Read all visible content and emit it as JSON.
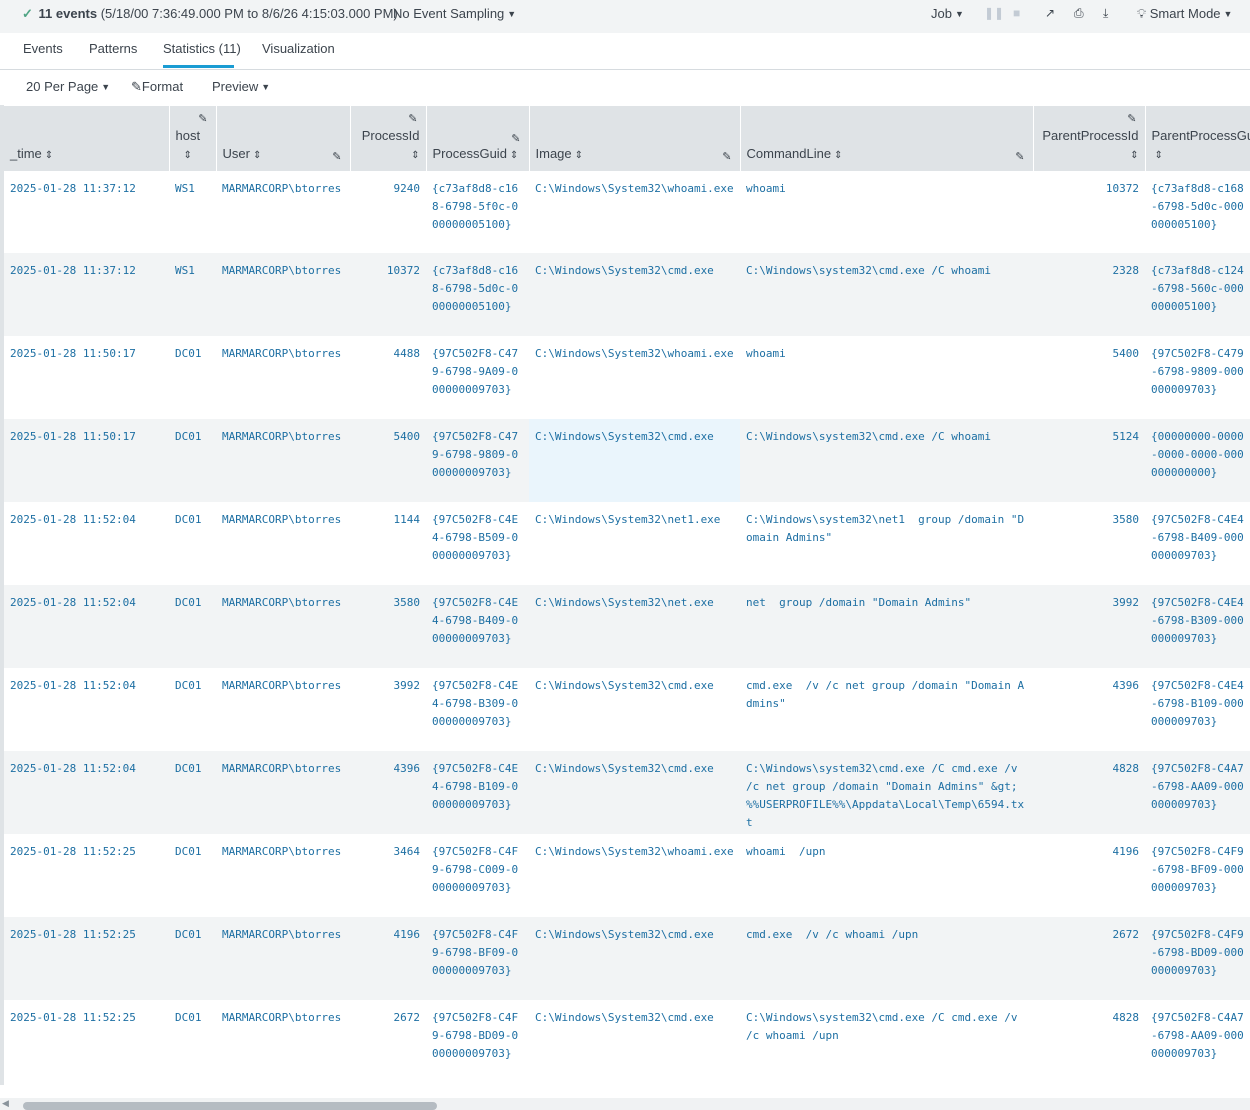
{
  "search_status": {
    "check": "✓",
    "count_label": "11 events",
    "range_label": "(5/18/00 7:36:49.000 PM to 8/6/26 4:15:03.000 PM)",
    "sampling_label": "No Event Sampling",
    "job_label": "Job",
    "mode_label": "Smart Mode"
  },
  "tabs": [
    {
      "label": "Events"
    },
    {
      "label": "Patterns"
    },
    {
      "label": "Statistics (11)"
    },
    {
      "label": "Visualization"
    }
  ],
  "toolbar": {
    "per_page": "20 Per Page",
    "format": "Format",
    "preview": "Preview"
  },
  "columns": {
    "time": "_time",
    "host": "host",
    "user": "User",
    "pid": "ProcessId",
    "pguid": "ProcessGuid",
    "image": "Image",
    "cmd": "CommandLine",
    "ppid": "ParentProcessId",
    "ppguid": "ParentProcessGuid"
  },
  "rows": [
    {
      "time": "2025-01-28 11:37:12",
      "host": "WS1",
      "user": "MARMARCORP\\btorres",
      "pid": "9240",
      "pguid": "{c73af8d8-c168-6798-5f0c-000000005100}",
      "image": "C:\\Windows\\System32\\whoami.exe",
      "cmd": "whoami",
      "ppid": "10372",
      "ppguid": "{c73af8d8-c168-6798-5d0c-000000005100}"
    },
    {
      "time": "2025-01-28 11:37:12",
      "host": "WS1",
      "user": "MARMARCORP\\btorres",
      "pid": "10372",
      "pguid": "{c73af8d8-c168-6798-5d0c-000000005100}",
      "image": "C:\\Windows\\System32\\cmd.exe",
      "cmd": "C:\\Windows\\system32\\cmd.exe /C whoami",
      "ppid": "2328",
      "ppguid": "{c73af8d8-c124-6798-560c-000000005100}"
    },
    {
      "time": "2025-01-28 11:50:17",
      "host": "DC01",
      "user": "MARMARCORP\\btorres",
      "pid": "4488",
      "pguid": "{97C502F8-C479-6798-9A09-000000009703}",
      "image": "C:\\Windows\\System32\\whoami.exe",
      "cmd": "whoami",
      "ppid": "5400",
      "ppguid": "{97C502F8-C479-6798-9809-000000009703}"
    },
    {
      "time": "2025-01-28 11:50:17",
      "host": "DC01",
      "user": "MARMARCORP\\btorres",
      "pid": "5400",
      "pguid": "{97C502F8-C479-6798-9809-000000009703}",
      "image": "C:\\Windows\\System32\\cmd.exe",
      "cmd": "C:\\Windows\\system32\\cmd.exe /C whoami",
      "ppid": "5124",
      "ppguid": "{00000000-0000-0000-0000-000000000000}"
    },
    {
      "time": "2025-01-28 11:52:04",
      "host": "DC01",
      "user": "MARMARCORP\\btorres",
      "pid": "1144",
      "pguid": "{97C502F8-C4E4-6798-B509-000000009703}",
      "image": "C:\\Windows\\System32\\net1.exe",
      "cmd": "C:\\Windows\\system32\\net1  group /domain \"Domain Admins\"",
      "ppid": "3580",
      "ppguid": "{97C502F8-C4E4-6798-B409-000000009703}"
    },
    {
      "time": "2025-01-28 11:52:04",
      "host": "DC01",
      "user": "MARMARCORP\\btorres",
      "pid": "3580",
      "pguid": "{97C502F8-C4E4-6798-B409-000000009703}",
      "image": "C:\\Windows\\System32\\net.exe",
      "cmd": "net  group /domain \"Domain Admins\"",
      "ppid": "3992",
      "ppguid": "{97C502F8-C4E4-6798-B309-000000009703}"
    },
    {
      "time": "2025-01-28 11:52:04",
      "host": "DC01",
      "user": "MARMARCORP\\btorres",
      "pid": "3992",
      "pguid": "{97C502F8-C4E4-6798-B309-000000009703}",
      "image": "C:\\Windows\\System32\\cmd.exe",
      "cmd": "cmd.exe  /v /c net group /domain \"Domain Admins\"",
      "ppid": "4396",
      "ppguid": "{97C502F8-C4E4-6798-B109-000000009703}"
    },
    {
      "time": "2025-01-28 11:52:04",
      "host": "DC01",
      "user": "MARMARCORP\\btorres",
      "pid": "4396",
      "pguid": "{97C502F8-C4E4-6798-B109-000000009703}",
      "image": "C:\\Windows\\System32\\cmd.exe",
      "cmd": "C:\\Windows\\system32\\cmd.exe /C cmd.exe /v /c net group /domain \"Domain Admins\" &gt; %%USERPROFILE%%\\Appdata\\Local\\Temp\\6594.txt",
      "ppid": "4828",
      "ppguid": "{97C502F8-C4A7-6798-AA09-000000009703}"
    },
    {
      "time": "2025-01-28 11:52:25",
      "host": "DC01",
      "user": "MARMARCORP\\btorres",
      "pid": "3464",
      "pguid": "{97C502F8-C4F9-6798-C009-000000009703}",
      "image": "C:\\Windows\\System32\\whoami.exe",
      "cmd": "whoami  /upn",
      "ppid": "4196",
      "ppguid": "{97C502F8-C4F9-6798-BF09-000000009703}"
    },
    {
      "time": "2025-01-28 11:52:25",
      "host": "DC01",
      "user": "MARMARCORP\\btorres",
      "pid": "4196",
      "pguid": "{97C502F8-C4F9-6798-BF09-000000009703}",
      "image": "C:\\Windows\\System32\\cmd.exe",
      "cmd": "cmd.exe  /v /c whoami /upn",
      "ppid": "2672",
      "ppguid": "{97C502F8-C4F9-6798-BD09-000000009703}"
    },
    {
      "time": "2025-01-28 11:52:25",
      "host": "DC01",
      "user": "MARMARCORP\\btorres",
      "pid": "2672",
      "pguid": "{97C502F8-C4F9-6798-BD09-000000009703}",
      "image": "C:\\Windows\\System32\\cmd.exe",
      "cmd": "C:\\Windows\\system32\\cmd.exe /C cmd.exe /v /c whoami /upn",
      "ppid": "4828",
      "ppguid": "{97C502F8-C4A7-6798-AA09-000000009703}"
    }
  ]
}
